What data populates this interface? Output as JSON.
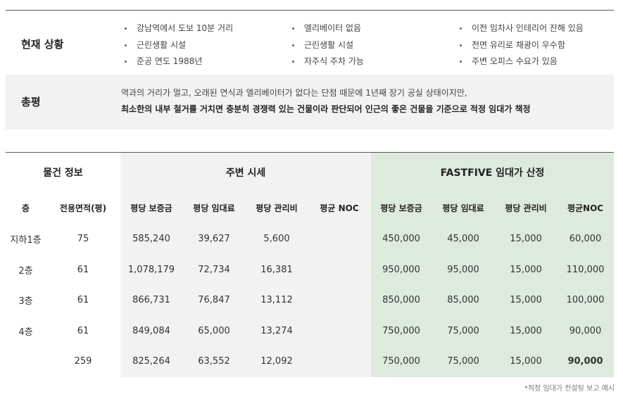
{
  "summary": {
    "status": {
      "label": "현재 상황",
      "col1": [
        "강남역에서 도보 10분 거리",
        "근린생활 시설",
        "준공 연도 1988년"
      ],
      "col2": [
        "엘리베이터 없음",
        "근린생활 시설",
        "자주식 주차 가능"
      ],
      "col3": [
        "이전 임차사 인테리어 잔해 있음",
        "전면 유리로 채광이 우수함",
        "주변 오피스 수요가 있음"
      ]
    },
    "verdict": {
      "label": "총평",
      "line1": "역과의 거리가 멀고, 오래된 연식과 엘리베이터가 없다는 단점 때문에 1년째 장기 공실 상태이지만,",
      "line2": "최소한의 내부 철거를 거치면 충분히 경쟁력 있는 건물이라 판단되어 인근의 좋은 건물을 기준으로 적정 임대가 책정"
    }
  },
  "pricing": {
    "groups": {
      "property": "물건 정보",
      "market": "주변 시세",
      "fastfive": "FASTFIVE 임대가 산정"
    },
    "columns": [
      "층",
      "전용면적(평)",
      "평당 보증금",
      "평당 임대료",
      "평당 관리비",
      "평균 NOC",
      "평당 보증금",
      "평당 임대료",
      "평당 관리비",
      "평균NOC"
    ],
    "rows": [
      [
        "지하1층",
        "75",
        "585,240",
        "39,627",
        "5,600",
        "",
        "450,000",
        "45,000",
        "15,000",
        "60,000"
      ],
      [
        "2층",
        "61",
        "1,078,179",
        "72,734",
        "16,381",
        "",
        "950,000",
        "95,000",
        "15,000",
        "110,000"
      ],
      [
        "3층",
        "61",
        "866,731",
        "76,847",
        "13,112",
        "",
        "850,000",
        "85,000",
        "15,000",
        "100,000"
      ],
      [
        "4층",
        "61",
        "849,084",
        "65,000",
        "13,274",
        "",
        "750,000",
        "75,000",
        "15,000",
        "90,000"
      ],
      [
        "",
        "259",
        "825,264",
        "63,552",
        "12,092",
        "",
        "750,000",
        "75,000",
        "15,000",
        "90,000"
      ]
    ],
    "note": "*적정 임대가 컨설팅 보고 예시"
  }
}
